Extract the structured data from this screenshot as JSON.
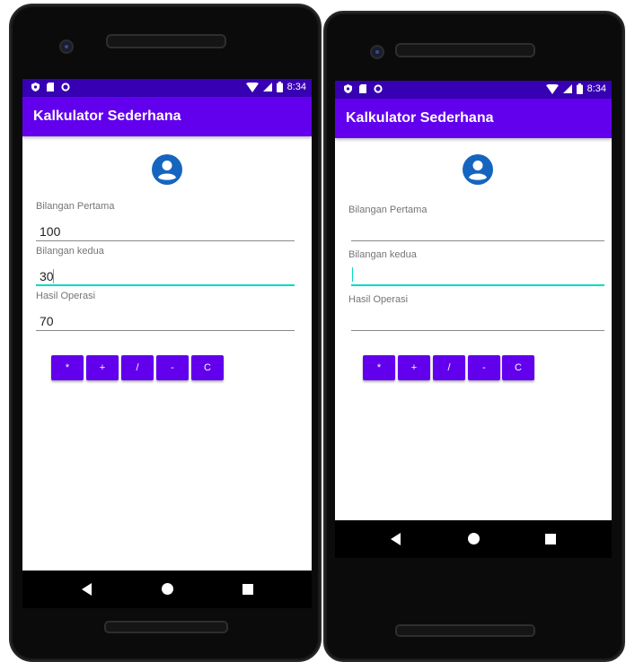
{
  "phones": [
    {
      "status_time": "8:34",
      "app_title": "Kalkulator Sederhana",
      "fields": [
        {
          "label": "Bilangan Pertama",
          "value": "100"
        },
        {
          "label": "Bilangan kedua",
          "value": "30"
        },
        {
          "label": "Hasil Operasi",
          "value": "70"
        }
      ],
      "buttons": [
        "*",
        "+",
        "/",
        "-",
        "C"
      ],
      "focused_field": "Bilangan kedua"
    },
    {
      "status_time": "8:34",
      "app_title": "Kalkulator Sederhana",
      "fields": [
        {
          "label": "Bilangan Pertama",
          "value": ""
        },
        {
          "label": "Bilangan kedua",
          "value": ""
        },
        {
          "label": "Hasil Operasi",
          "value": ""
        }
      ],
      "buttons": [
        "*",
        "+",
        "/",
        "-",
        "C"
      ],
      "focused_field": "Bilangan kedua"
    }
  ],
  "colors": {
    "primary": "#6200ee",
    "primary_dark": "#3700b3",
    "accent": "#03dac5",
    "avatar_blue": "#1565c0"
  },
  "icons": [
    "shield-icon",
    "sim-card-icon",
    "circle-icon",
    "wifi-icon",
    "cell-signal-icon",
    "battery-icon",
    "account-circle-icon",
    "back-icon",
    "home-icon",
    "recents-icon"
  ]
}
